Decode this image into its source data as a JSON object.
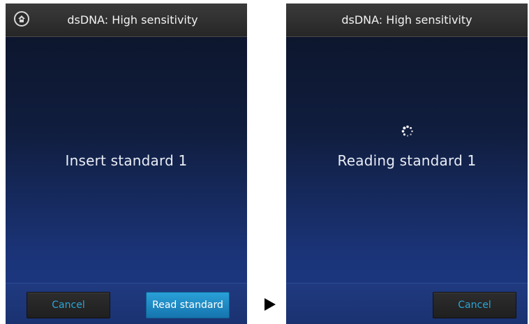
{
  "left_screen": {
    "title": "dsDNA: High sensitivity",
    "message": "Insert standard 1",
    "home_icon": "home-icon",
    "cancel_label": "Cancel",
    "read_label": "Read standard"
  },
  "right_screen": {
    "title": "dsDNA: High sensitivity",
    "message": "Reading standard 1",
    "spinner_icon": "loading-spinner-icon",
    "cancel_label": "Cancel"
  },
  "transition_icon": "right-arrow-icon",
  "colors": {
    "accent": "#2aa6d8",
    "primary_button": "#1e8ac4",
    "titlebar": "#2f2f2f",
    "background_top": "#0c1428",
    "background_bottom": "#1c3a86"
  }
}
